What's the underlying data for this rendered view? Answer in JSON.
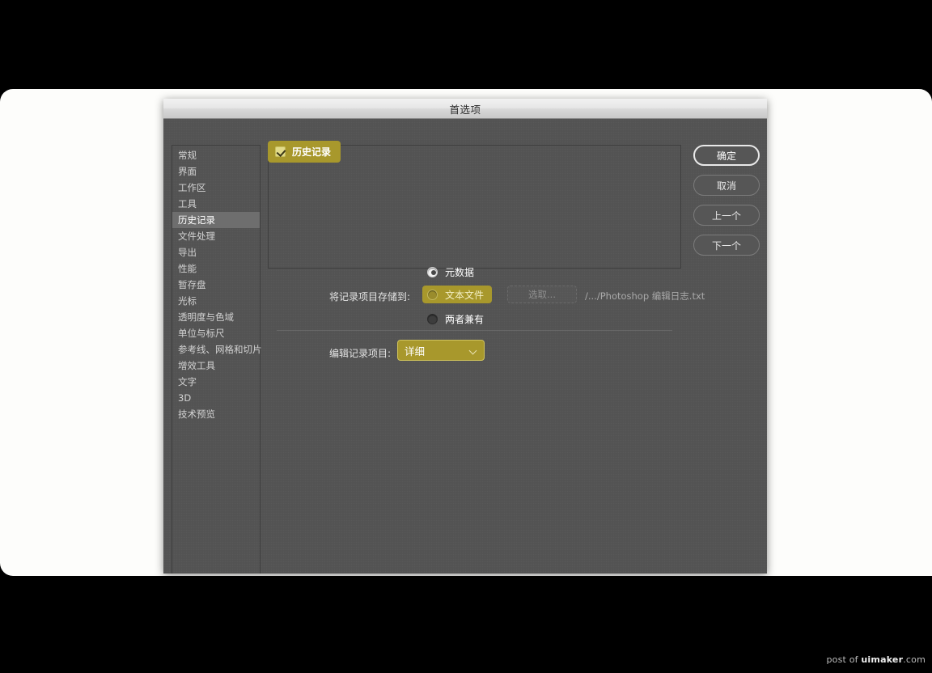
{
  "window": {
    "title": "首选项"
  },
  "sidebar": {
    "items": [
      {
        "label": "常规",
        "selected": false
      },
      {
        "label": "界面",
        "selected": false
      },
      {
        "label": "工作区",
        "selected": false
      },
      {
        "label": "工具",
        "selected": false
      },
      {
        "label": "历史记录",
        "selected": true
      },
      {
        "label": "文件处理",
        "selected": false
      },
      {
        "label": "导出",
        "selected": false
      },
      {
        "label": "性能",
        "selected": false
      },
      {
        "label": "暂存盘",
        "selected": false
      },
      {
        "label": "光标",
        "selected": false
      },
      {
        "label": "透明度与色域",
        "selected": false
      },
      {
        "label": "单位与标尺",
        "selected": false
      },
      {
        "label": "参考线、网格和切片",
        "selected": false
      },
      {
        "label": "增效工具",
        "selected": false
      },
      {
        "label": "文字",
        "selected": false
      },
      {
        "label": "3D",
        "selected": false
      },
      {
        "label": "技术预览",
        "selected": false
      }
    ]
  },
  "panel": {
    "group": {
      "label": "历史记录",
      "checked": true
    },
    "save_row": {
      "label": "将记录项目存储到:",
      "options": [
        {
          "label": "元数据",
          "selected": true,
          "highlighted": false
        },
        {
          "label": "文本文件",
          "selected": false,
          "highlighted": true
        },
        {
          "label": "两者兼有",
          "selected": false,
          "highlighted": false
        }
      ],
      "choose_button": "选取...",
      "path": "/.../Photoshop 编辑日志.txt"
    },
    "edit_row": {
      "label": "编辑记录项目:",
      "value": "详细"
    }
  },
  "buttons": [
    {
      "label": "确定",
      "primary": true
    },
    {
      "label": "取消",
      "primary": false
    },
    {
      "label": "上一个",
      "primary": false
    },
    {
      "label": "下一个",
      "primary": false
    }
  ],
  "watermark": {
    "prefix": "post of ",
    "brand": "uimaker",
    "suffix": ".com"
  },
  "colors": {
    "accent": "#a8982c",
    "dialog_bg": "#545454",
    "selected_item": "#6e6e6e",
    "page_surface": "#fdfdfb"
  }
}
